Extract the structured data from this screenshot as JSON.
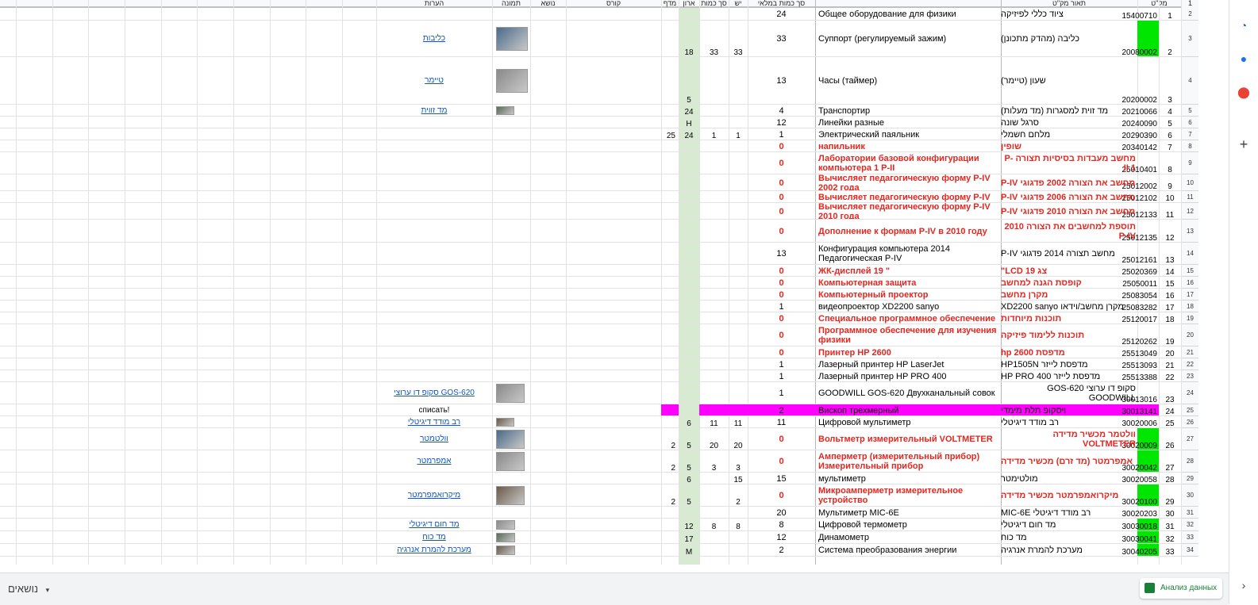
{
  "headers": {
    "sku": "מק\"ט",
    "desc": "תאור מק\"ט",
    "qty_full": "סך כמות במלאי",
    "yesh": "יש",
    "total_qty": "סך כמות",
    "aron": "ארון",
    "madaf": "מדף",
    "course": "קורס",
    "topic": "נושא",
    "image": "תמונה",
    "notes": "הערות",
    "row_one": "1"
  },
  "rows": [
    {
      "rn": "2",
      "idx": "1",
      "sku": "15400710",
      "he": "ציוד כללי לפיזיקה",
      "ru": "Общее оборудование для физики",
      "q": "24"
    },
    {
      "rn": "3",
      "idx": "2",
      "sku": "20080002",
      "he": "כליבה (מהדק מתכונן)",
      "ru": "Суппорт (регулируемый зажим)",
      "q": "33",
      "yesh": "33",
      "total": "33",
      "aron": "18",
      "note": "כליבות",
      "sku_green": true
    },
    {
      "rn": "4",
      "idx": "3",
      "sku": "20200002",
      "he": "שעון (טיימר)",
      "ru": "Часы (таймер)",
      "q": "13",
      "aron": "5",
      "note": "טיימר"
    },
    {
      "rn": "5",
      "idx": "4",
      "sku": "20210066",
      "he": "מד זוית למסגרות (מד מעלות)",
      "ru": "Транспортир",
      "q": "4",
      "aron": "24",
      "note": "מד זווית"
    },
    {
      "rn": "6",
      "idx": "5",
      "sku": "20240090",
      "he": "סרגל שונה",
      "ru": "Линейки разные",
      "q": "12",
      "aron": "H"
    },
    {
      "rn": "7",
      "idx": "6",
      "sku": "20290390",
      "he": "מלחם חשמלי",
      "ru": "Электрический паяльник",
      "q": "1",
      "yesh": "1",
      "total": "1",
      "aron": "24",
      "madaf": "25"
    },
    {
      "rn": "8",
      "idx": "7",
      "sku": "20340142",
      "he": "שופין",
      "ru": "напильник",
      "q": "0",
      "red": true
    },
    {
      "rn": "9",
      "idx": "8",
      "sku": "25010401",
      "he": "מחשב מעבדות בסיסיות תצורה P-II 1",
      "ru": "Лаборатории базовой конфигурации компьютера 1 P-II",
      "q": "0",
      "red": true
    },
    {
      "rn": "10",
      "idx": "9",
      "sku": "25012002",
      "he": "מחשב את הצורה 2002 פדגוגי P-IV",
      "ru": "Вычисляет педагогическую форму P-IV 2002 года",
      "q": "0",
      "red": true
    },
    {
      "rn": "11",
      "idx": "10",
      "sku": "25012102",
      "he": "מחשב את הצורה 2006 פדגוגי P-IV",
      "ru": "Вычисляет педагогическую форму P-IV",
      "q": "0",
      "red": true
    },
    {
      "rn": "12",
      "idx": "11",
      "sku": "25012133",
      "he": "מחשב את הצורה 2010 פדגוגי P-IV",
      "ru": "Вычисляет педагогическую форму P-IV 2010 года",
      "q": "0",
      "red": true
    },
    {
      "rn": "13",
      "idx": "12",
      "sku": "25012135",
      "he": "תוספת למחשבים את הצורה 2010 P-IV",
      "ru": "Дополнение к формам P-IV в 2010 году",
      "q": "0",
      "red": true
    },
    {
      "rn": "14",
      "idx": "13",
      "sku": "25012161",
      "he": "מחשב תצורה 2014 פדגוגי P-IV",
      "ru": "Конфигурация компьютера 2014 Педагогическая P-IV",
      "q": "13"
    },
    {
      "rn": "15",
      "idx": "14",
      "sku": "25020369",
      "he": "צג LCD 19\"",
      "ru": "ЖК-дисплей 19 \"",
      "q": "0",
      "red": true
    },
    {
      "rn": "16",
      "idx": "15",
      "sku": "25050011",
      "he": "קופסת הגנה למחשב",
      "ru": "Компьютерная защита",
      "q": "0",
      "red": true
    },
    {
      "rn": "17",
      "idx": "16",
      "sku": "25083054",
      "he": "מקרן מחשב",
      "ru": "Компьютерный проектор",
      "q": "0",
      "red": true
    },
    {
      "rn": "18",
      "idx": "17",
      "sku": "25083282",
      "he": "מקרן מחשב/וידאו XD2200 sanyo",
      "ru": "видеопроектор XD2200 sanyo",
      "q": "1"
    },
    {
      "rn": "19",
      "idx": "18",
      "sku": "25120017",
      "he": "תוכנות מיוחדות",
      "ru": "Специальное программное обеспечение",
      "q": "0",
      "red": true
    },
    {
      "rn": "20",
      "idx": "19",
      "sku": "25120262",
      "he": "תוכנות ללימוד פיזיקה",
      "ru": "Программное обеспечение для изучения физики",
      "q": "0",
      "red": true
    },
    {
      "rn": "21",
      "idx": "20",
      "sku": "25513049",
      "he": "מדפסת hp 2600",
      "ru": "Принтер HP 2600",
      "q": "0",
      "red": true
    },
    {
      "rn": "22",
      "idx": "21",
      "sku": "25513093",
      "he": "מדפסת לייזר HP1505N",
      "ru": "Лазерный принтер HP LaserJet",
      "q": "1"
    },
    {
      "rn": "23",
      "idx": "22",
      "sku": "25513388",
      "he": "מדפסת לייזר HP PRO 400",
      "ru": "Лазерный принтер HP PRO 400",
      "q": "1"
    },
    {
      "rn": "24",
      "idx": "23",
      "sku": "30013016",
      "he": "סקופ דו ערוצי GOS-620 GOODWILL",
      "ru": "GOODWILL GOS-620 Двухканальный совок",
      "q": "1",
      "note": "סקופ דו ערוצי GOS-620"
    },
    {
      "rn": "25",
      "idx": "24",
      "sku": "30013141",
      "he": "ויסקופ תלת מימדי",
      "ru": "Вископ трехмерный",
      "q": "2",
      "note": "списать!",
      "magenta": true
    },
    {
      "rn": "26",
      "idx": "25",
      "sku": "30020006",
      "he": "רב מודד דיגיטלי",
      "ru": "Цифровой мультиметр",
      "q": "11",
      "yesh": "11",
      "total": "11",
      "aron": "6",
      "note": "רב מודד דיגיטלי"
    },
    {
      "rn": "27",
      "idx": "26",
      "sku": "30020009",
      "he": "וולטמר מכשיר מדידה VOLTMETER",
      "ru": "Вольтметр измерительный VOLTMETER",
      "q": "0",
      "yesh": "20",
      "total": "20",
      "aron": "5",
      "madaf": "2",
      "note": "וולטמטר",
      "red": true,
      "sku_green": true
    },
    {
      "rn": "28",
      "idx": "27",
      "sku": "30020042",
      "he": "אמפרמטר (מד זרם) מכשיר מדידה",
      "ru": "Амперметр (измерительный прибор) Измерительный прибор",
      "q": "0",
      "yesh": "3",
      "total": "3",
      "aron": "5",
      "madaf": "2",
      "note": "אמפרמטר",
      "red": true,
      "sku_green": true
    },
    {
      "rn": "29",
      "idx": "28",
      "sku": "30020058",
      "he": "מולטימטר",
      "ru": "мультиметр",
      "q": "15",
      "yesh": "15",
      "aron": "6"
    },
    {
      "rn": "30",
      "idx": "29",
      "sku": "30020100",
      "he": "מיקרואמפרמטר מכשיר מדידה",
      "ru": "Микроамперметр измерительное устройство",
      "q": "0",
      "yesh": "2",
      "aron": "5",
      "madaf": "2",
      "note": "מיקרואמפרמטר",
      "red": true,
      "sku_green": true
    },
    {
      "rn": "31",
      "idx": "30",
      "sku": "30020203",
      "he": "רב מודד דיגיטלי MIC-6E",
      "ru": "Мультиметр MIC-6E",
      "q": "20"
    },
    {
      "rn": "32",
      "idx": "31",
      "sku": "30030018",
      "he": "מד חום דיגיטלי",
      "ru": "Цифровой термометр",
      "q": "8",
      "yesh": "8",
      "total": "8",
      "aron": "12",
      "note": "מד חום דיגיטלי",
      "sku_green": true
    },
    {
      "rn": "33",
      "idx": "32",
      "sku": "30030041",
      "he": "מד כוח",
      "ru": "Динамометр",
      "q": "12",
      "aron": "17",
      "note": "מד כוח",
      "sku_green": true
    },
    {
      "rn": "34",
      "idx": "33",
      "sku": "30040205",
      "he": "מערכת להמרת אנרגיה",
      "ru": "Система преобразования энергии",
      "q": "2",
      "aron": "M",
      "note": "מערכת להמרת אנרגיה",
      "sku_green": true
    }
  ],
  "sheet_tab": "נושאים",
  "explore_label": "Анализ данных",
  "colors": {
    "green": "#00e600",
    "red": "#e6261f",
    "magenta": "#ff00ff",
    "aron_bg": "#d9ead3",
    "link": "#1155cc"
  },
  "icons": [
    "calendar-icon",
    "contacts-icon",
    "maps-icon",
    "add-icon"
  ]
}
